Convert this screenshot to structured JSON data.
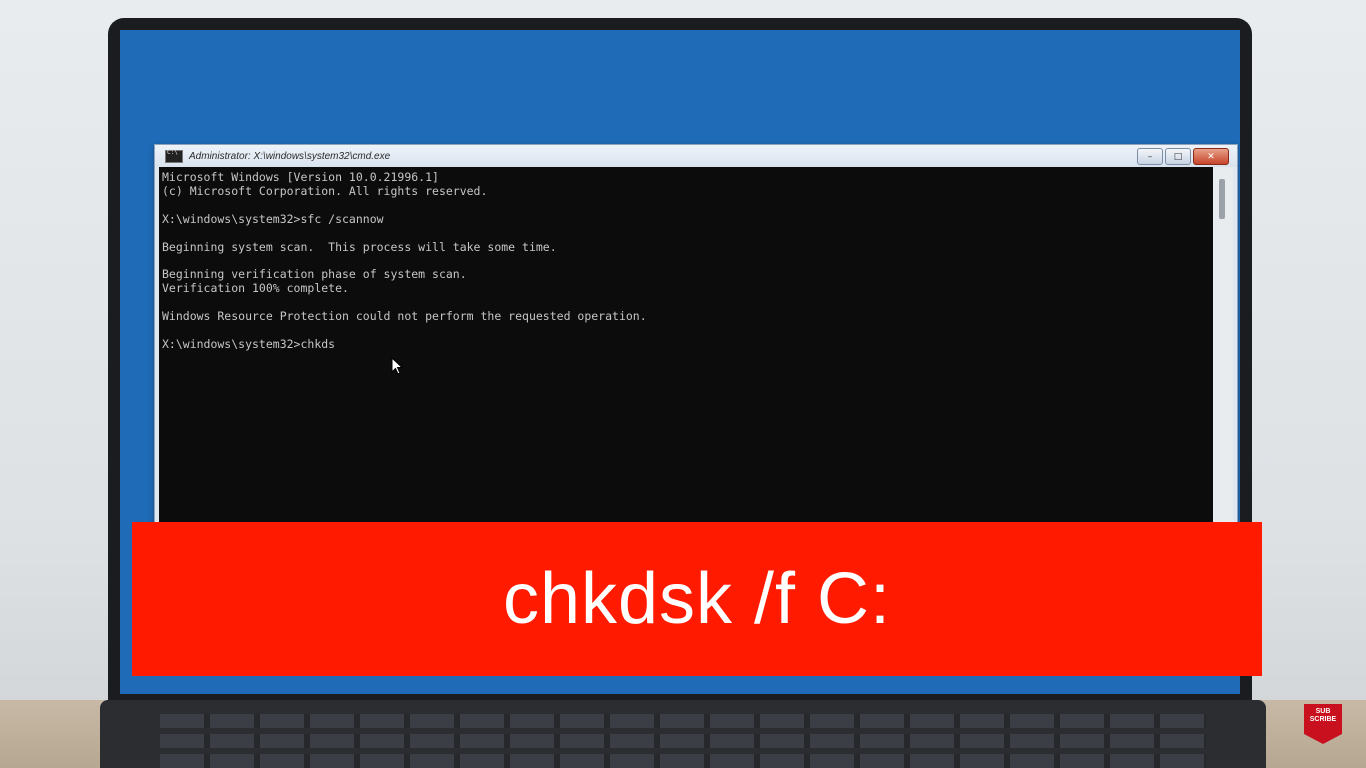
{
  "window": {
    "title": "Administrator: X:\\windows\\system32\\cmd.exe",
    "minimize_glyph": "–",
    "maximize_glyph": "□",
    "close_glyph": "✕"
  },
  "console": {
    "lines": [
      "Microsoft Windows [Version 10.0.21996.1]",
      "(c) Microsoft Corporation. All rights reserved.",
      "",
      "X:\\windows\\system32>sfc /scannow",
      "",
      "Beginning system scan.  This process will take some time.",
      "",
      "Beginning verification phase of system scan.",
      "Verification 100% complete.",
      "",
      "Windows Resource Protection could not perform the requested operation.",
      "",
      "X:\\windows\\system32>chkds"
    ]
  },
  "caption": {
    "text": "chkdsk /f C:"
  },
  "subscribe_badge": {
    "line1": "SUB",
    "line2": "SCRIBE"
  },
  "colors": {
    "desktop_blue": "#1f6bb8",
    "caption_red": "#ff1a00",
    "console_bg": "#0c0c0c",
    "console_text": "#c6c6c6"
  }
}
